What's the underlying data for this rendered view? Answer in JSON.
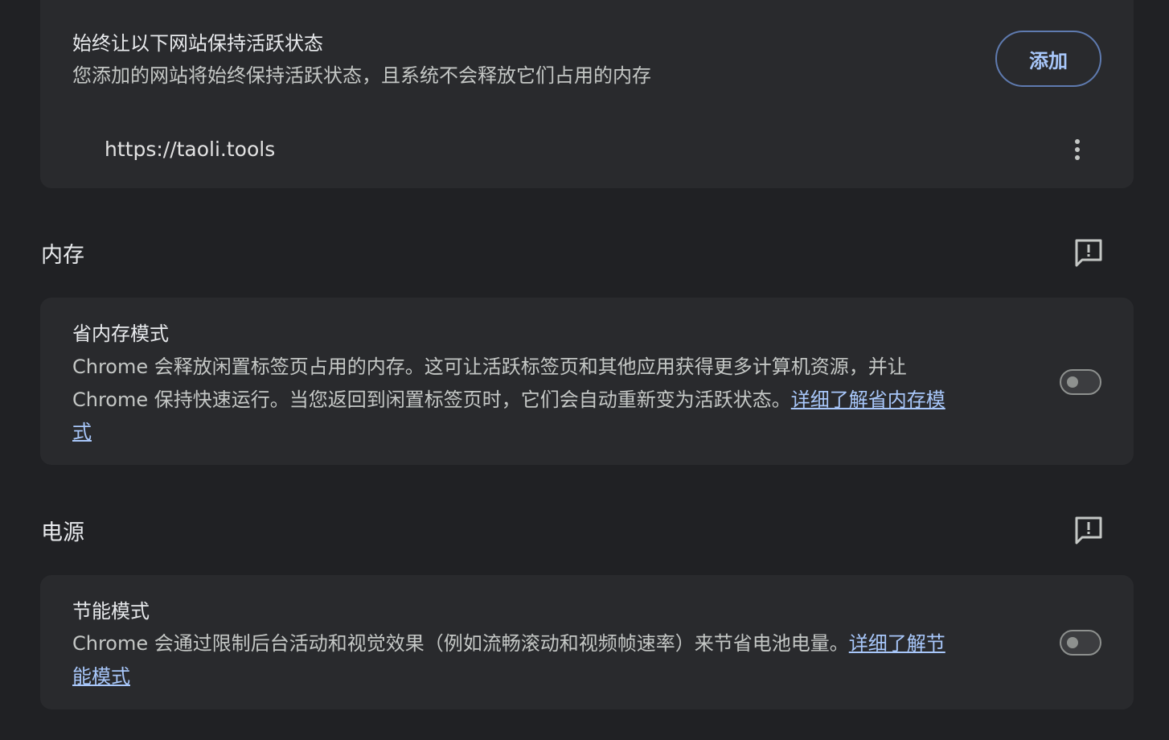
{
  "keep_active": {
    "title": "始终让以下网站保持活跃状态",
    "description": "您添加的网站将始终保持活跃状态，且系统不会释放它们占用的内存",
    "add_label": "添加",
    "sites": [
      "https://taoli.tools"
    ]
  },
  "memory": {
    "header": "内存",
    "mode_title": "省内存模式",
    "mode_desc_line1": "Chrome 会释放闲置标签页占用的内存。这可让活跃标签页和其他应用获得更多计算机资源，并让",
    "mode_desc_line2": "Chrome 保持快速运行。当您返回到闲置标签页时，它们会自动重新变为活跃状态。",
    "learn_more_part1": "详细了解省内存模",
    "learn_more_part2": "式",
    "enabled": false
  },
  "power": {
    "header": "电源",
    "mode_title": "节能模式",
    "mode_desc": "Chrome 会通过限制后台活动和视觉效果（例如流畅滚动和视频帧速率）来节省电池电量。",
    "learn_more_part1": "详细了解节",
    "learn_more_part2": "能模式",
    "enabled": false
  },
  "colors": {
    "background": "#202124",
    "card": "#292a2d",
    "link": "#a8c7fa"
  },
  "icons": {
    "menu": "more-vert-icon",
    "feedback": "feedback-icon"
  }
}
